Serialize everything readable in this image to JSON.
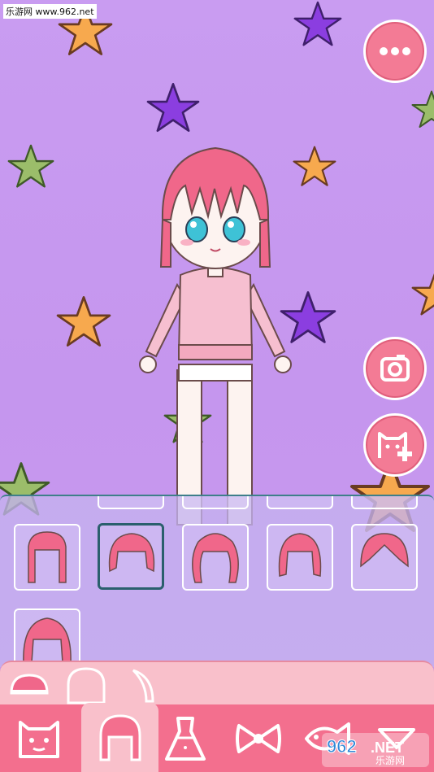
{
  "watermark": "乐游网 www.962.net",
  "colors": {
    "accent": "#f37b95",
    "panel_selected": "#2b5f6d",
    "hair": "#f0678a",
    "sweater": "#f6bfd0"
  },
  "icons": {
    "more": "more-dots-icon",
    "camera": "camera-icon",
    "new_character": "cat-face-plus-icon"
  },
  "hair_items": [
    {
      "name": "hair-style-1",
      "selected": false
    },
    {
      "name": "hair-style-2",
      "selected": true
    },
    {
      "name": "hair-style-3",
      "selected": false
    },
    {
      "name": "hair-style-4",
      "selected": false
    },
    {
      "name": "hair-style-5",
      "selected": false
    },
    {
      "name": "hair-style-6",
      "selected": false
    }
  ],
  "subtabs": [
    "front-hair",
    "back-hair",
    "side-hair"
  ],
  "categories": [
    "face",
    "hair",
    "dress",
    "bow",
    "fish-accessory",
    "more"
  ],
  "active_category": "hair",
  "logo": {
    "main": "962.NET",
    "sub": "乐游网"
  }
}
